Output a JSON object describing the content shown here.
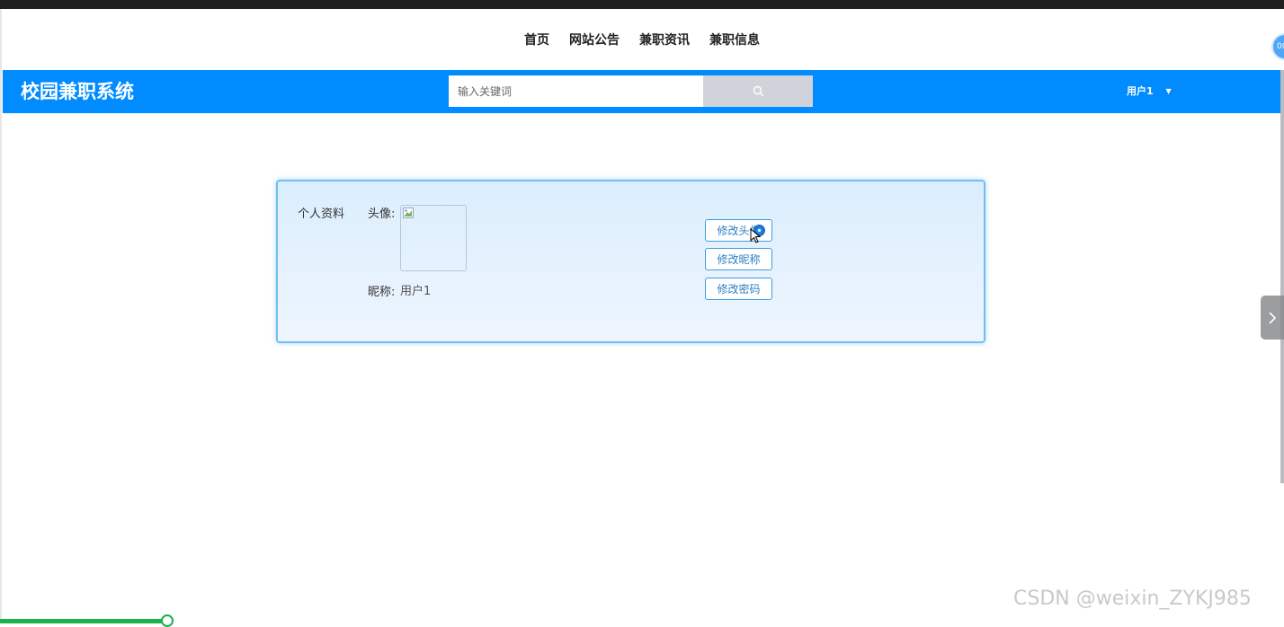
{
  "top_nav": {
    "items": [
      "首页",
      "网站公告",
      "兼职资讯",
      "兼职信息"
    ]
  },
  "header": {
    "site_title": "校园兼职系统",
    "search_placeholder": "输入关键词",
    "search_icon": "search-icon",
    "user_menu_label": "用户1",
    "accent_color": "#008cff"
  },
  "profile": {
    "section_title": "个人资料",
    "avatar_label": "头像:",
    "nickname_label": "昵称:",
    "nickname_value": "用户1",
    "buttons": {
      "change_avatar": "修改头像",
      "change_nickname": "修改昵称",
      "change_password": "修改密码"
    }
  },
  "float_badge": "00",
  "watermark": "CSDN @weixin_ZYKJ985",
  "media_progress": 0.13
}
